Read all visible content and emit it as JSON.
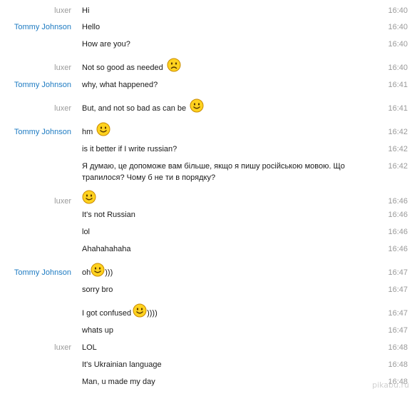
{
  "senders": {
    "luxer": "luxer",
    "tommy": "Tommy Johnson"
  },
  "messages": [
    {
      "sender": "luxer",
      "text": "Hi",
      "time": "16:40"
    },
    {
      "sender": "Tommy Johnson",
      "text": "Hello",
      "time": "16:40"
    },
    {
      "sender": "",
      "text": "How are you?",
      "time": "16:40"
    },
    {
      "sender": "luxer",
      "text": "Not so good as needed",
      "emoticon": "sad-face-icon",
      "time": "16:40"
    },
    {
      "sender": "Tommy Johnson",
      "text": "why, what happened?",
      "time": "16:41"
    },
    {
      "sender": "luxer",
      "text": "But, and not so bad as can be",
      "emoticon": "smile-icon",
      "time": "16:41"
    },
    {
      "sender": "Tommy Johnson",
      "text": "hm",
      "emoticon": "smile-icon",
      "time": "16:42"
    },
    {
      "sender": "",
      "text": "is it better if I write russian?",
      "time": "16:42"
    },
    {
      "sender": "",
      "text_line1": "Я думаю, це допоможе вам більше, якщо я пишу російською мовою. Що",
      "text_line2": "трапилося? Чому б не ти в порядку?",
      "time": "16:42"
    },
    {
      "sender": "luxer",
      "text": "",
      "emoticon": "smile-icon",
      "time": "16:46"
    },
    {
      "sender": "",
      "text": "It's not Russian",
      "time": "16:46"
    },
    {
      "sender": "",
      "text": "lol",
      "time": "16:46"
    },
    {
      "sender": "",
      "text": "Ahahahahaha",
      "time": "16:46"
    },
    {
      "sender": "Tommy Johnson",
      "text": "oh",
      "emoticon": "smile-icon",
      "text_after": ")))",
      "time": "16:47"
    },
    {
      "sender": "",
      "text": "sorry bro",
      "time": "16:47"
    },
    {
      "sender": "",
      "text": "I got confused",
      "emoticon": "smile-icon",
      "text_after": "))))",
      "time": "16:47"
    },
    {
      "sender": "",
      "text": "whats up",
      "time": "16:47"
    },
    {
      "sender": "luxer",
      "text": "LOL",
      "time": "16:48"
    },
    {
      "sender": "",
      "text": "It's Ukrainian language",
      "time": "16:48"
    },
    {
      "sender": "",
      "text": "Man, u made my day",
      "time": "16:48"
    }
  ],
  "watermark": "pikabu.ru",
  "colors": {
    "luxer_name": "#9a9a9a",
    "tommy_name": "#1e7bc2",
    "timestamp": "#9a9a9a",
    "emoticon_fill": "#ffd21f",
    "emoticon_stroke": "#c88a00"
  }
}
